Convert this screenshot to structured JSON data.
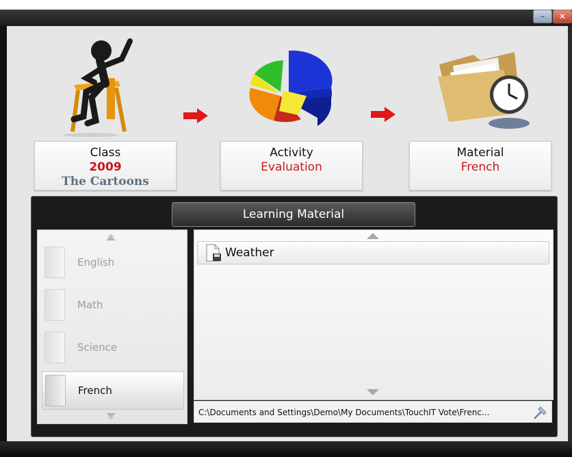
{
  "window": {
    "minimize_icon": "minimize-icon",
    "close_icon": "close-icon"
  },
  "steps": {
    "class": {
      "label": "Class",
      "year": "2009",
      "group": "The Cartoons"
    },
    "activity": {
      "label": "Activity",
      "value": "Evaluation"
    },
    "material": {
      "label": "Material",
      "value": "French"
    }
  },
  "panel": {
    "title": "Learning Material",
    "subjects": [
      {
        "label": "English",
        "selected": false
      },
      {
        "label": "Math",
        "selected": false
      },
      {
        "label": "Science",
        "selected": false
      },
      {
        "label": "French",
        "selected": true
      }
    ],
    "files": [
      {
        "label": "Weather"
      }
    ],
    "path": "C:\\Documents and Settings\\Demo\\My Documents\\TouchIT Vote\\Frenc..."
  },
  "colors": {
    "accent_red": "#c8171c",
    "arrow_red": "#e01818",
    "dark_frame": "#1b1b1b"
  }
}
